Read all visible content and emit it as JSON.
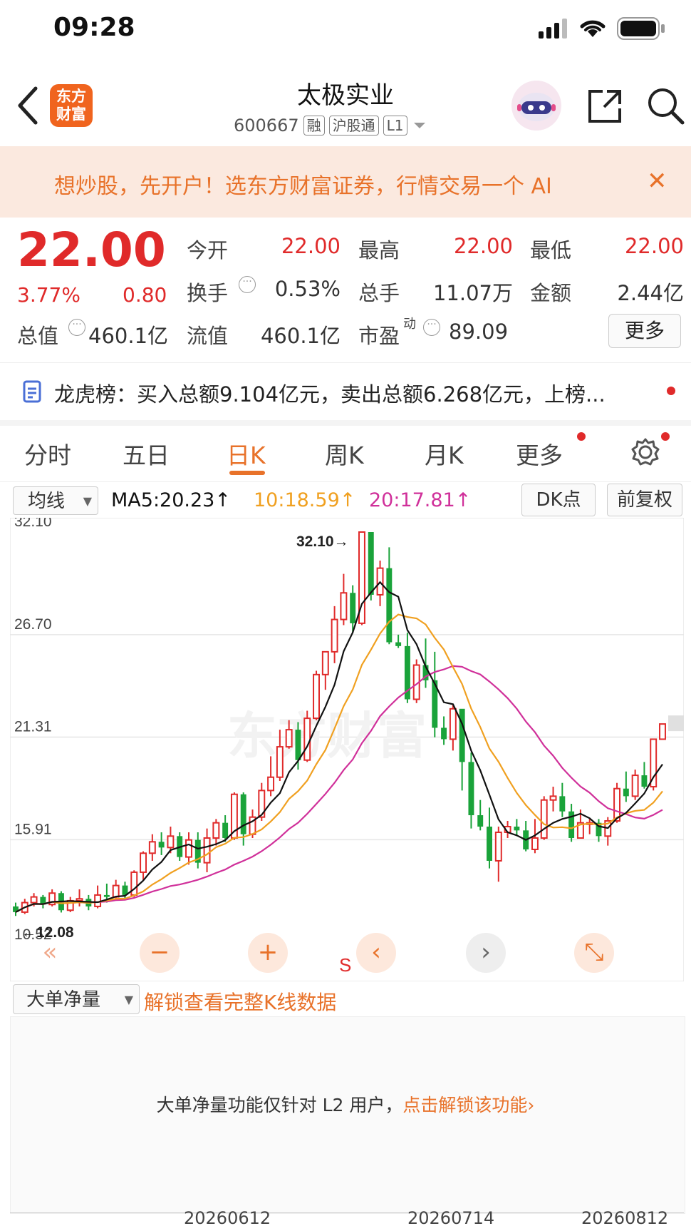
{
  "status_bar": {
    "time": "09:28"
  },
  "header": {
    "app_logo_text": [
      "东方",
      "财富"
    ],
    "stock_name": "太极实业",
    "stock_code": "600667",
    "tags": [
      "融",
      "沪股通",
      "L1"
    ]
  },
  "banner": {
    "text": "想炒股，先开户！选东方财富证券，行情交易一个 AI",
    "close": "✕"
  },
  "quote": {
    "price": "22.00",
    "change_pct": "3.77%",
    "change": "0.80",
    "fields": [
      {
        "label": "今开",
        "value": "22.00",
        "color": "red"
      },
      {
        "label": "最高",
        "value": "22.00",
        "color": "red"
      },
      {
        "label": "最低",
        "value": "22.00",
        "color": "red"
      },
      {
        "label": "换手",
        "value": "0.53%",
        "color": "dark"
      },
      {
        "label": "总手",
        "value": "11.07万",
        "color": "dark"
      },
      {
        "label": "金额",
        "value": "2.44亿",
        "color": "dark"
      },
      {
        "label": "总值",
        "value": "460.1亿",
        "color": "dark"
      },
      {
        "label": "流值",
        "value": "460.1亿",
        "color": "dark"
      },
      {
        "label": "市盈",
        "label_sup": "动",
        "value": "89.09",
        "color": "dark"
      }
    ],
    "more_label": "更多"
  },
  "dragon_tiger": {
    "text": "龙虎榜：买入总额9.104亿元，卖出总额6.268亿元，上榜..."
  },
  "tabs": [
    "分时",
    "五日",
    "日K",
    "周K",
    "月K",
    "更多"
  ],
  "active_tab": "日K",
  "ma_bar": {
    "selector": "均线",
    "ma5": "MA5:20.23↑",
    "ma10": "10:18.59↑",
    "ma20": "20:17.81↑",
    "dk_button": "DK点",
    "adjust_button": "前复权"
  },
  "colors": {
    "up": "#e02a2a",
    "down": "#1aa33a",
    "ma5": "#111111",
    "ma10": "#f0a020",
    "ma20": "#d0309a",
    "accent": "#e8722a"
  },
  "chart_data": {
    "type": "candlestick",
    "y_ticks": [
      "32.10",
      "26.70",
      "21.31",
      "15.91",
      "10.52"
    ],
    "ylim": [
      10.52,
      32.1
    ],
    "max_marker": "32.10→",
    "min_marker": "←12.08",
    "watermark": "东方财富",
    "s_marker": "S",
    "x_labels": [
      "20260612",
      "20260714",
      "20260812"
    ],
    "candles": [
      [
        12.4,
        12.1,
        12.6,
        11.9
      ],
      [
        12.1,
        12.6,
        12.8,
        12.0
      ],
      [
        12.6,
        12.9,
        13.1,
        12.4
      ],
      [
        12.9,
        12.5,
        13.0,
        12.3
      ],
      [
        12.5,
        13.1,
        13.3,
        12.4
      ],
      [
        13.1,
        12.2,
        13.2,
        12.08
      ],
      [
        12.2,
        12.7,
        12.9,
        12.1
      ],
      [
        12.7,
        12.8,
        13.3,
        12.4
      ],
      [
        12.8,
        12.4,
        13.0,
        12.2
      ],
      [
        12.4,
        13.0,
        13.5,
        12.3
      ],
      [
        13.0,
        12.9,
        13.6,
        12.6
      ],
      [
        12.9,
        13.5,
        13.8,
        12.7
      ],
      [
        13.5,
        13.0,
        13.7,
        12.8
      ],
      [
        13.0,
        14.2,
        14.3,
        12.9
      ],
      [
        14.2,
        15.2,
        15.3,
        13.8
      ],
      [
        15.2,
        15.8,
        16.2,
        14.8
      ],
      [
        15.8,
        15.5,
        16.3,
        15.1
      ],
      [
        15.5,
        16.1,
        16.6,
        15.2
      ],
      [
        16.1,
        15.0,
        16.3,
        14.8
      ],
      [
        15.0,
        15.9,
        16.3,
        14.6
      ],
      [
        15.9,
        14.7,
        16.3,
        14.4
      ],
      [
        14.7,
        16.0,
        16.5,
        14.2
      ],
      [
        16.0,
        16.8,
        17.0,
        15.6
      ],
      [
        16.8,
        16.0,
        17.2,
        15.8
      ],
      [
        16.0,
        18.3,
        18.4,
        15.9
      ],
      [
        18.3,
        16.2,
        18.4,
        15.6
      ],
      [
        16.2,
        17.1,
        17.5,
        16.0
      ],
      [
        17.1,
        18.5,
        18.9,
        16.9
      ],
      [
        18.5,
        19.2,
        20.3,
        18.2
      ],
      [
        19.2,
        20.8,
        21.7,
        19.0
      ],
      [
        20.8,
        21.7,
        22.2,
        20.7
      ],
      [
        21.7,
        20.1,
        22.1,
        19.6
      ],
      [
        20.1,
        22.3,
        22.7,
        20.0
      ],
      [
        22.3,
        24.6,
        24.8,
        22.2
      ],
      [
        24.6,
        25.8,
        25.8,
        23.8
      ],
      [
        25.8,
        27.5,
        28.2,
        25.2
      ],
      [
        27.5,
        28.9,
        29.9,
        27.2
      ],
      [
        28.9,
        27.3,
        29.3,
        26.8
      ],
      [
        27.3,
        32.1,
        32.1,
        27.2
      ],
      [
        32.1,
        28.8,
        32.0,
        28.5
      ],
      [
        28.8,
        30.2,
        30.6,
        28.2
      ],
      [
        30.2,
        26.3,
        31.3,
        26.2
      ],
      [
        26.3,
        26.1,
        26.7,
        26.0
      ],
      [
        26.1,
        23.3,
        26.8,
        23.1
      ],
      [
        23.3,
        25.1,
        25.4,
        23.1
      ],
      [
        25.1,
        24.3,
        26.5,
        23.9
      ],
      [
        24.3,
        21.8,
        25.8,
        21.3
      ],
      [
        21.8,
        21.2,
        22.4,
        20.9
      ],
      [
        21.2,
        22.8,
        23.0,
        20.6
      ],
      [
        22.8,
        20.0,
        22.5,
        18.5
      ],
      [
        20.0,
        17.2,
        20.5,
        16.5
      ],
      [
        17.2,
        16.6,
        18.0,
        16.4
      ],
      [
        16.6,
        14.8,
        17.6,
        14.4
      ],
      [
        14.8,
        16.3,
        16.6,
        13.7
      ],
      [
        16.3,
        16.6,
        16.9,
        16.0
      ],
      [
        16.6,
        16.4,
        17.0,
        16.1
      ],
      [
        16.4,
        15.4,
        16.9,
        15.3
      ],
      [
        15.4,
        16.0,
        17.0,
        15.2
      ],
      [
        16.0,
        18.0,
        18.2,
        15.9
      ],
      [
        18.0,
        18.2,
        18.7,
        17.4
      ],
      [
        18.2,
        17.4,
        18.9,
        17.1
      ],
      [
        17.4,
        16.0,
        17.8,
        15.8
      ],
      [
        16.0,
        16.8,
        17.5,
        16.0
      ],
      [
        16.8,
        16.8,
        17.0,
        16.2
      ],
      [
        16.8,
        16.1,
        17.0,
        15.8
      ],
      [
        16.1,
        16.9,
        17.1,
        15.6
      ],
      [
        16.9,
        18.6,
        18.9,
        16.8
      ],
      [
        18.6,
        18.2,
        19.5,
        17.9
      ],
      [
        18.2,
        19.3,
        19.6,
        18.0
      ],
      [
        19.3,
        18.7,
        20.0,
        18.6
      ],
      [
        18.7,
        21.2,
        21.2,
        18.5
      ],
      [
        21.2,
        22.0,
        22.0,
        21.2
      ]
    ],
    "ma5_last": 20.23,
    "ma10_last": 18.59,
    "ma20_last": 17.81
  },
  "chart_controls": [
    "«",
    "−",
    "+",
    "‹",
    "›",
    "⤡"
  ],
  "bottom_panel": {
    "selector": "大单净量",
    "unlock_link": "解锁查看完整K线数据",
    "l2_text": "大单净量功能仅针对 L2 用户，",
    "l2_link": "点击解锁该功能",
    "l2_arrow": "›"
  }
}
